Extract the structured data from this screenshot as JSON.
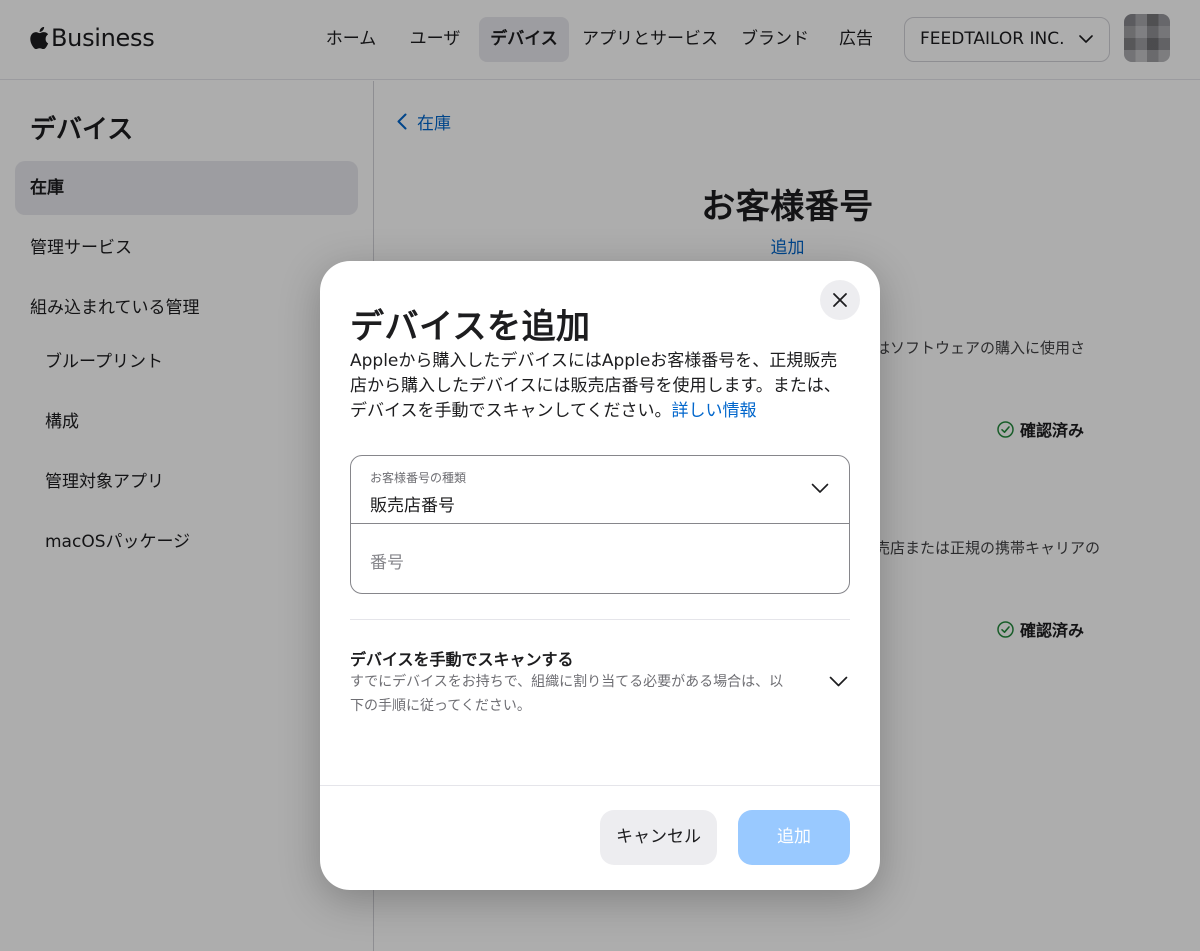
{
  "header": {
    "brand": "Business",
    "nav": [
      {
        "label": "ホーム",
        "active": false
      },
      {
        "label": "ユーザ",
        "active": false
      },
      {
        "label": "デバイス",
        "active": true
      },
      {
        "label": "アプリとサービス",
        "active": false
      },
      {
        "label": "ブランド",
        "active": false
      },
      {
        "label": "広告",
        "active": false
      }
    ],
    "org": "FEEDTAILOR INC."
  },
  "sidebar": {
    "title": "デバイス",
    "items": [
      {
        "label": "在庫",
        "active": true
      },
      {
        "label": "管理サービス"
      },
      {
        "label": "組み込まれている管理"
      },
      {
        "label": "ブループリント"
      },
      {
        "label": "構成"
      },
      {
        "label": "管理対象アプリ"
      },
      {
        "label": "macOSパッケージ"
      }
    ]
  },
  "main": {
    "back": "在庫",
    "title": "お客様番号",
    "add": "追加",
    "fragment1": "はソフトウェアの購入に使用さ",
    "verified1": "確認済み",
    "fragment2": "売店または正規の携帯キャリアの",
    "verified2": "確認済み"
  },
  "modal": {
    "title": "デバイスを追加",
    "description": "Appleから購入したデバイスにはAppleお客様番号を、正規販売店から購入したデバイスには販売店番号を使用します。または、デバイスを手動でスキャンしてください。",
    "learn_more": "詳しい情報",
    "type_label": "お客様番号の種類",
    "type_value": "販売店番号",
    "number_placeholder": "番号",
    "scan_title": "デバイスを手動でスキャンする",
    "scan_desc": "すでにデバイスをお持ちで、組織に割り当てる必要がある場合は、以下の手順に従ってください。",
    "cancel": "キャンセル",
    "add": "追加"
  },
  "colors": {
    "accent": "#0066cc",
    "primary_disabled": "#99c9ff",
    "verified": "#248a3d"
  },
  "icons": {
    "logo": "apple-logo-icon",
    "org_dropdown": "chevron-down-icon",
    "back": "chevron-left-icon",
    "verified": "checkmark-circle-icon",
    "close": "close-icon",
    "type_dropdown": "chevron-down-icon",
    "scan_expand": "chevron-down-icon"
  }
}
